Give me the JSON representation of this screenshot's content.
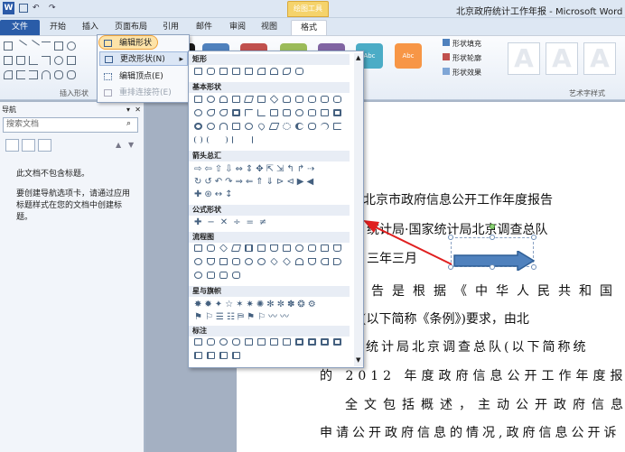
{
  "quick_access": {
    "undo": "↶",
    "redo": "↷"
  },
  "context_tab": "绘图工具",
  "doc_title": "北京政府统计工作年报 - Microsoft Word",
  "tabs": [
    "文件",
    "开始",
    "插入",
    "页面布局",
    "引用",
    "邮件",
    "审阅",
    "视图",
    "格式"
  ],
  "ribbon": {
    "group_insert_shapes": "插入形状",
    "style_label": "Abc",
    "shape_fill": "形状填充",
    "shape_outline": "形状轮廓",
    "shape_effect": "形状效果",
    "wordart_group": "艺术字样式",
    "wordart_letter": "A"
  },
  "edit_menu": {
    "edit_shape": "编辑形状",
    "change_shape": "更改形状(N)",
    "edit_points": "编辑顶点(E)",
    "reroute": "重排连接符(E)"
  },
  "gallery": {
    "sections": [
      "矩形",
      "基本形状",
      "箭头总汇",
      "公式形状",
      "流程图",
      "星与旗帜",
      "标注"
    ]
  },
  "nav_pane": {
    "title": "导航",
    "search_placeholder": "搜索文档",
    "empty_text": "此文档不包含标题。",
    "help_text": "要创建导航选项卡，请通过应用标题样式在您的文档中创建标题。"
  },
  "document": {
    "lines": [
      "于北京市政府信息公开工作年度报告",
      "统计局·国家统计局北京调查总队",
      "三年三月",
      "报告是根据《中华人民共和国",
      "例》(以下简称《条例》)要求，由北",
      "家统计局北京调查总队(以下简称统",
      "的 2012 年度政府信息公开工作年度报告",
      "全文包括概述，主动公开政府信息",
      "申请公开政府信息的情况,政府信息公开诉"
    ]
  },
  "colors": {
    "file_tab": "#2a5ca8",
    "shape_styles": [
      "#1a1a1a",
      "#4f81bd",
      "#c0504d",
      "#9bbb59",
      "#8064a2",
      "#4bacc6",
      "#f79646"
    ],
    "arrow_fill": "#4f81bd"
  }
}
